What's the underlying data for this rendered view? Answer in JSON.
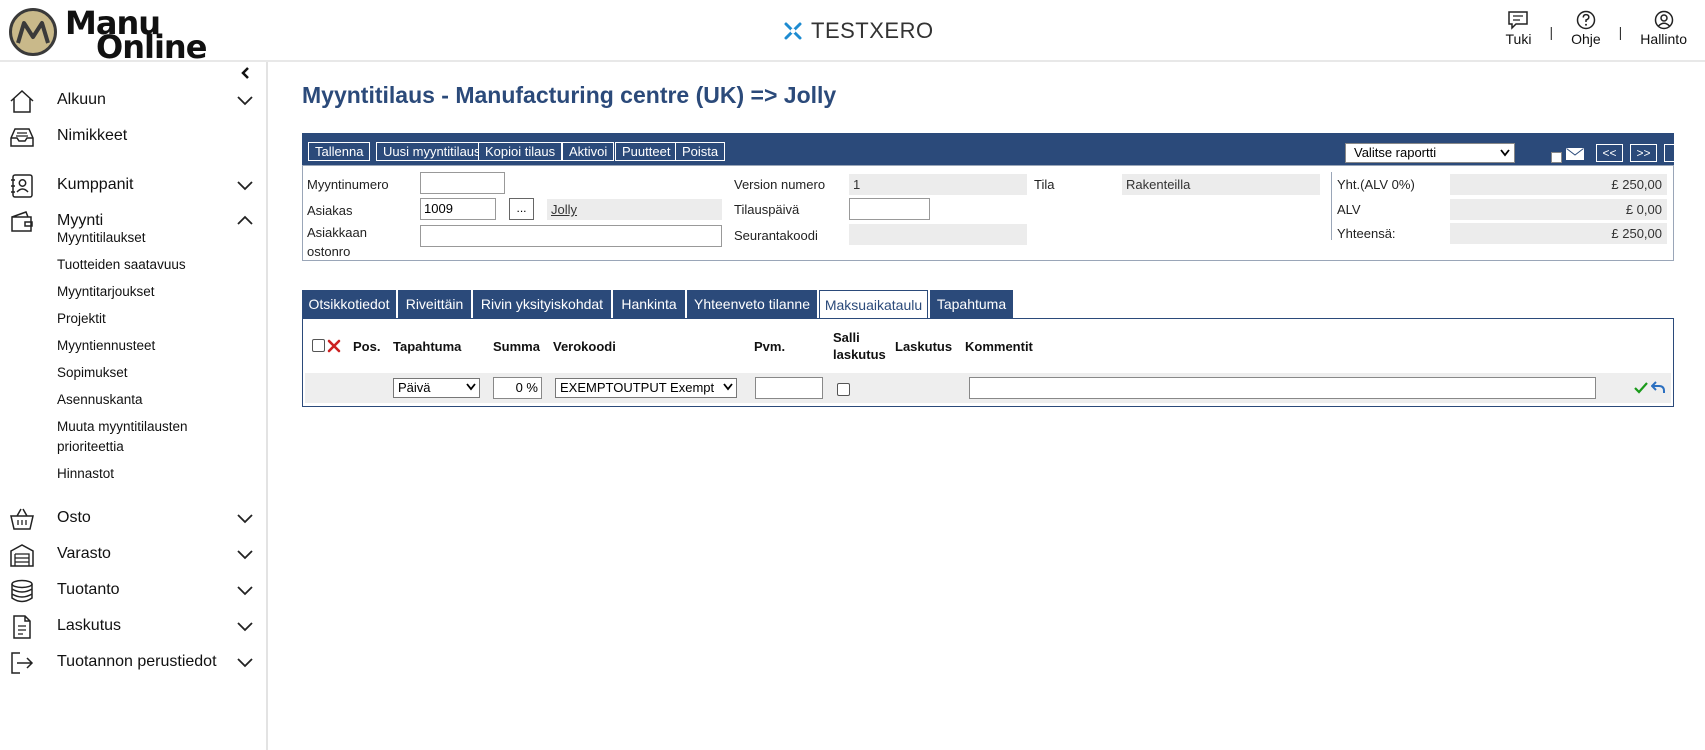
{
  "header": {
    "logo_line1": "Manu",
    "logo_line2": "Online",
    "company": "TESTXERO",
    "links": [
      {
        "label": "Tuki",
        "icon": "chat-icon"
      },
      {
        "label": "Ohje",
        "icon": "help-icon"
      },
      {
        "label": "Hallinto",
        "icon": "user-icon"
      }
    ],
    "separator": "|"
  },
  "sidebar": {
    "collapse_icon": "chevron-left-icon",
    "items": [
      {
        "label": "Alkuun",
        "icon": "home-icon",
        "chevron": "down"
      },
      {
        "label": "Nimikkeet",
        "icon": "inbox-icon",
        "chevron": ""
      },
      {
        "label": "Kumppanit",
        "icon": "contacts-icon",
        "chevron": "down"
      },
      {
        "label": "Myynti",
        "icon": "wallet-icon",
        "chevron": "up"
      },
      {
        "label": "Osto",
        "icon": "basket-icon",
        "chevron": "down"
      },
      {
        "label": "Varasto",
        "icon": "warehouse-icon",
        "chevron": "down"
      },
      {
        "label": "Tuotanto",
        "icon": "database-icon",
        "chevron": "down"
      },
      {
        "label": "Laskutus",
        "icon": "document-icon",
        "chevron": "down"
      },
      {
        "label": "Tuotannon perustiedot",
        "icon": "logout-icon",
        "chevron": "down"
      }
    ],
    "sub_items": [
      "Myyntitilaukset",
      "Tuotteiden saatavuus",
      "Myyntitarjoukset",
      "Projektit",
      "Myyntiennusteet",
      "Sopimukset",
      "Asennuskanta",
      "Muuta myyntitilausten",
      "prioriteettia",
      "Hinnastot"
    ]
  },
  "page": {
    "title": "Myyntitilaus - Manufacturing centre (UK) => Jolly"
  },
  "toolbar": {
    "buttons": [
      "Tallenna",
      "Uusi myyntitilaus",
      "Kopioi tilaus",
      "Aktivoi",
      "Puutteet",
      "Poista"
    ],
    "report_select": "Valitse raportti",
    "prev": "<<",
    "next": ">>",
    "attach_icon": "paperclip-icon"
  },
  "form": {
    "order_number_label": "Myyntinumero",
    "order_number_value": "",
    "customer_label": "Asiakas",
    "customer_value": "1009",
    "customer_lookup": "...",
    "customer_name": "Jolly",
    "customer_po_label_1": "Asiakkaan",
    "customer_po_label_2": "ostonro",
    "customer_po_value": "",
    "version_label": "Version numero",
    "version_value": "1",
    "order_date_label": "Tilauspäivä",
    "order_date_value": "",
    "tracking_label": "Seurantakoodi",
    "tracking_value": "",
    "status_label": "Tila",
    "status_value": "Rakenteilla",
    "net_label": "Yht.(ALV 0%)",
    "net_value": "£ 250,00",
    "vat_label": "ALV",
    "vat_value": "£ 0,00",
    "total_label": "Yhteensä:",
    "total_value": "£ 250,00"
  },
  "tabs": [
    {
      "label": "Otsikkotiedot",
      "active": false
    },
    {
      "label": "Riveittäin",
      "active": false
    },
    {
      "label": "Rivin yksityiskohdat",
      "active": false
    },
    {
      "label": "Hankinta",
      "active": false
    },
    {
      "label": "Yhteenveto tilanne",
      "active": false
    },
    {
      "label": "Maksuaikataulu",
      "active": true
    },
    {
      "label": "Tapahtuma",
      "active": false
    }
  ],
  "grid": {
    "headers": {
      "pos": "Pos.",
      "event": "Tapahtuma",
      "amount": "Summa",
      "tax_code": "Verokoodi",
      "date": "Pvm.",
      "allow_billing_1": "Salli",
      "allow_billing_2": "laskutus",
      "billing": "Laskutus",
      "comments": "Kommentit"
    },
    "row": {
      "event": "Päivä",
      "amount": "0 %",
      "tax_code": "EXEMPTOUTPUT Exempt",
      "date": "",
      "comment": ""
    },
    "colors": {
      "accent": "#2b4a7a",
      "delete": "#cc2222",
      "confirm": "#1a9a1a",
      "undo": "#2b6fc0"
    }
  }
}
